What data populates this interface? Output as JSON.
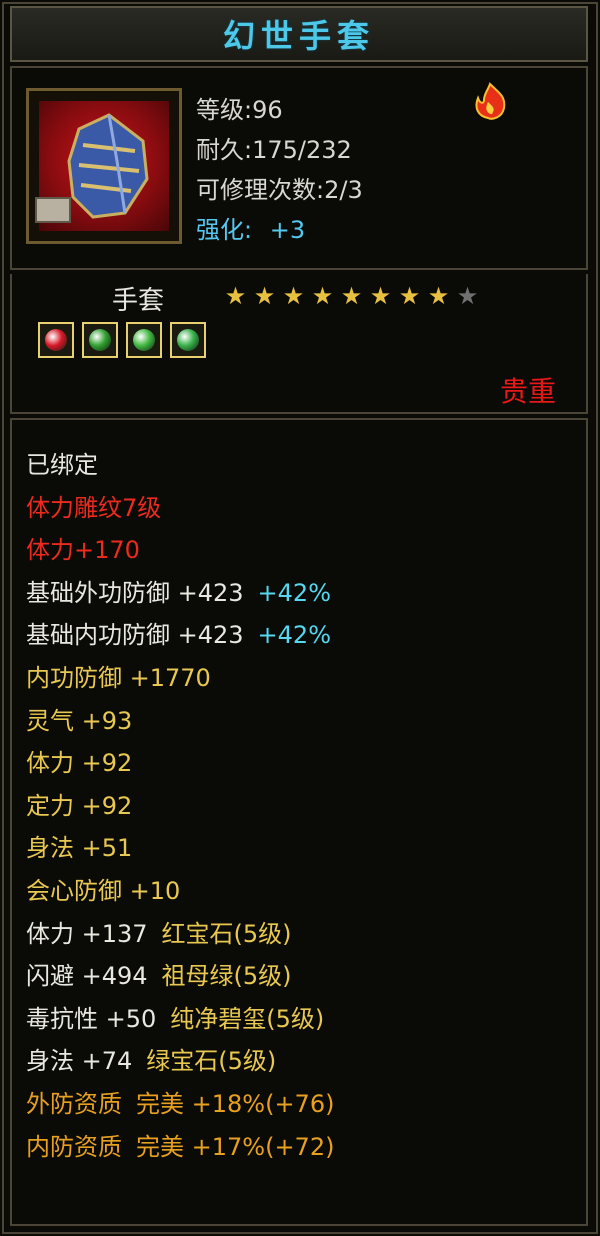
{
  "item": {
    "name": "幻世手套",
    "level_label": "等级:96",
    "durability_label": "耐久:175/232",
    "repair_label": "可修理次数:2/3",
    "strength_prefix": "强化:",
    "strength_value": "+3",
    "type": "手套",
    "stars_total": 9,
    "stars_lit": 8,
    "rarity": "贵重",
    "icon": "gauntlet-icon"
  },
  "gems": [
    {
      "name": "ruby-gem-icon",
      "color": "#d81828"
    },
    {
      "name": "emerald-gem-icon",
      "color": "#30a030"
    },
    {
      "name": "green-gem-icon",
      "color": "#40b840"
    },
    {
      "name": "jade-gem-icon",
      "color": "#38b048"
    }
  ],
  "attributes": [
    {
      "label": "已绑定",
      "color": "white"
    },
    {
      "label": "体力雕纹7级",
      "color": "red"
    },
    {
      "label": "体力+170",
      "color": "red"
    },
    {
      "label": "基础外功防御 +423",
      "color": "white",
      "extra": "+42%",
      "extra_color": "cyan"
    },
    {
      "label": "基础内功防御 +423",
      "color": "white",
      "extra": "+42%",
      "extra_color": "cyan"
    },
    {
      "label": "内功防御 +1770",
      "color": "gold"
    },
    {
      "label": "灵气 +93",
      "color": "gold"
    },
    {
      "label": "体力 +92",
      "color": "gold"
    },
    {
      "label": "定力 +92",
      "color": "gold"
    },
    {
      "label": "身法 +51",
      "color": "gold"
    },
    {
      "label": "会心防御 +10",
      "color": "gold"
    },
    {
      "label": "体力 +137",
      "color": "white",
      "extra": "红宝石(5级)",
      "extra_color": "gold"
    },
    {
      "label": "闪避 +494",
      "color": "white",
      "extra": "祖母绿(5级)",
      "extra_color": "gold"
    },
    {
      "label": "毒抗性 +50",
      "color": "white",
      "extra": "纯净碧玺(5级)",
      "extra_color": "gold"
    },
    {
      "label": "身法 +74",
      "color": "white",
      "extra": "绿宝石(5级)",
      "extra_color": "gold"
    },
    {
      "label": "外防资质",
      "color": "orange",
      "extra": "完美 +18%(+76)",
      "extra_color": "orange"
    },
    {
      "label": "内防资质",
      "color": "orange",
      "extra": "完美 +17%(+72)",
      "extra_color": "orange"
    }
  ]
}
